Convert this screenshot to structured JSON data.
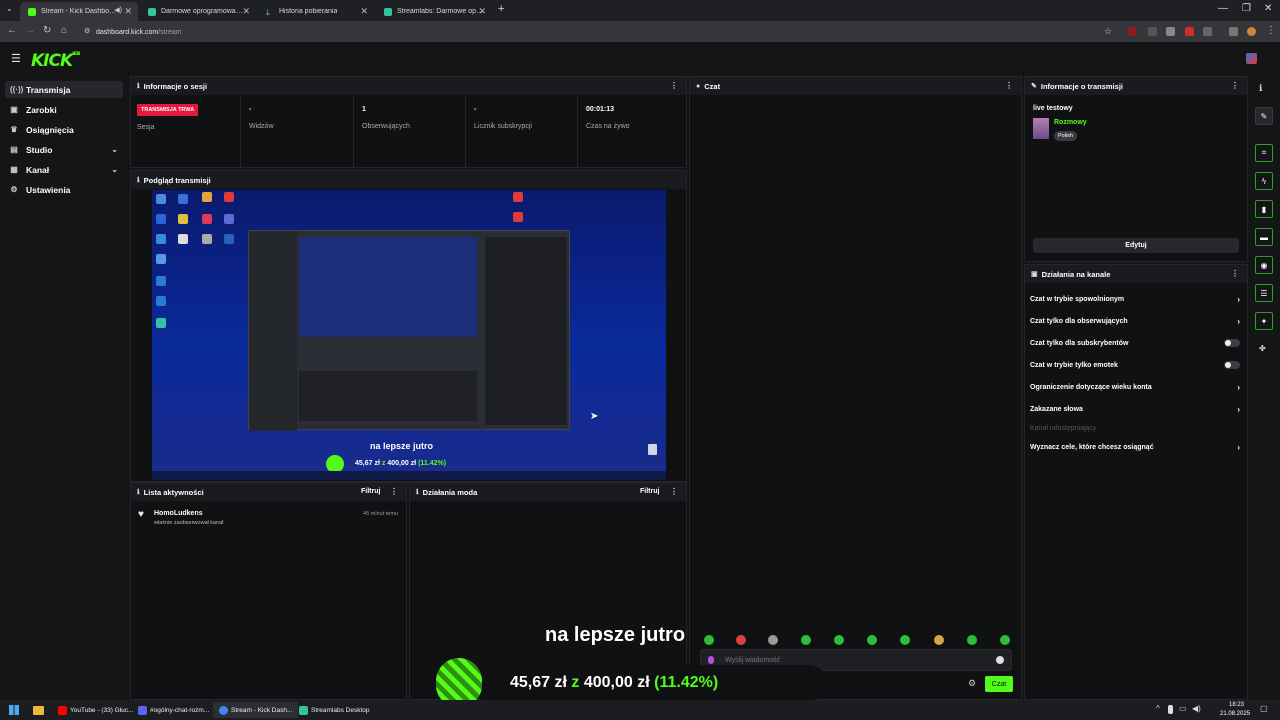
{
  "browser": {
    "tabs": [
      {
        "label": "Stream - Kick Dashboard",
        "color": "#53fc18"
      },
      {
        "label": "Darmowe oprogramowanie do",
        "color": "#31c3a2"
      },
      {
        "label": "Historia pobierania",
        "color": "#8ab4f8"
      },
      {
        "label": "Streamlabs: Darmowe oprogra",
        "color": "#31c3a2"
      }
    ],
    "url_host": "dashboard.kick.com",
    "url_path": "/stream",
    "new_tab": "+"
  },
  "sidebar": {
    "items": [
      {
        "label": "Transmisja",
        "icon": "broadcast-icon"
      },
      {
        "label": "Zarobki",
        "icon": "wallet-icon"
      },
      {
        "label": "Osiągnięcia",
        "icon": "trophy-icon"
      },
      {
        "label": "Studio",
        "icon": "studio-icon"
      },
      {
        "label": "Kanał",
        "icon": "channel-icon"
      },
      {
        "label": "Ustawienia",
        "icon": "gear-icon"
      }
    ]
  },
  "session": {
    "title": "Informacje o sesji",
    "badge": "TRANSMISJA TRWA",
    "session_label": "Sesja",
    "stats": [
      {
        "value": "-",
        "label": "Widzów"
      },
      {
        "value": "1",
        "label": "Obserwujących"
      },
      {
        "value": "-",
        "label": "Licznik subskrypcji"
      },
      {
        "value": "00:01:13",
        "label": "Czas na żywo"
      }
    ]
  },
  "preview": {
    "title": "Podgląd transmisji",
    "inner_caption": "na lepsze jutro",
    "inner_goal_amount": "45,67 zł",
    "inner_goal_sep": "z",
    "inner_goal_target": "400,00 zł",
    "inner_goal_pct": "(11.42%)"
  },
  "activity": {
    "title": "Lista aktywności",
    "filter": "Filtruj",
    "items": [
      {
        "user": "HomoLudkens",
        "text": "właśnie zaobserwował kanał",
        "time": "45 minut temu"
      }
    ]
  },
  "modactions": {
    "title": "Działania moda",
    "filter": "Filtruj"
  },
  "chat": {
    "title": "Czat",
    "placeholder": "Wyślij wiadomość",
    "send": "Czat"
  },
  "streaminfo": {
    "title": "Informacje o transmisji",
    "stream_title": "live testowy",
    "category": "Rozmowy",
    "language": "Polish",
    "edit": "Edytuj"
  },
  "channel_actions": {
    "title": "Działania na kanale",
    "items": [
      {
        "label": "Czat w trybie spowolnionym",
        "kind": "arrow"
      },
      {
        "label": "Czat tylko dla obserwujących",
        "kind": "arrow"
      },
      {
        "label": "Czat tylko dla subskrybentów",
        "kind": "toggle"
      },
      {
        "label": "Czat w trybie tylko emotek",
        "kind": "toggle"
      },
      {
        "label": "Ograniczenie dotyczące wieku konta",
        "kind": "arrow"
      },
      {
        "label": "Zakazane słowa",
        "kind": "arrow"
      },
      {
        "label": "Kanał udostępniający",
        "kind": "dim"
      },
      {
        "label": "Wyznacz cele, które chcesz osiągnąć",
        "kind": "arrow"
      }
    ]
  },
  "overlay": {
    "caption": "na lepsze jutro",
    "amount": "45,67 zł",
    "sep": "z",
    "target": "400,00 zł",
    "pct": "(11.42%)",
    "goal_fraction": 0.1142
  },
  "taskbar": {
    "apps": [
      {
        "label": "YouTube - (33) Głuc...",
        "color": "#ff0000"
      },
      {
        "label": "#ogólny-chat-rozm...",
        "color": "#5865f2"
      },
      {
        "label": "Stream - Kick Dash...",
        "color": "#4285f4"
      },
      {
        "label": "Streamlabs Desktop",
        "color": "#31c3a2"
      }
    ],
    "time": "18:23",
    "date": "21.08.2025"
  },
  "colors": {
    "accent": "#53fc18",
    "live": "#e5193b"
  }
}
